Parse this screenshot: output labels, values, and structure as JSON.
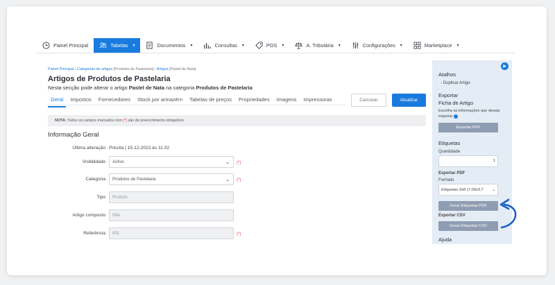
{
  "nav": {
    "items": [
      {
        "label": "Painel Principal",
        "icon": "clock-icon",
        "active": false,
        "dropdown": false
      },
      {
        "label": "Tabelas",
        "icon": "users-icon",
        "active": true,
        "dropdown": true
      },
      {
        "label": "Documentos",
        "icon": "document-icon",
        "active": false,
        "dropdown": true
      },
      {
        "label": "Consultas",
        "icon": "bar-chart-icon",
        "active": false,
        "dropdown": true
      },
      {
        "label": "POS",
        "icon": "tag-icon",
        "active": false,
        "dropdown": true
      },
      {
        "label": "A. Tributária",
        "icon": "scales-icon",
        "active": false,
        "dropdown": true
      },
      {
        "label": "Configurações",
        "icon": "sliders-icon",
        "active": false,
        "dropdown": true
      },
      {
        "label": "Marketplace",
        "icon": "grid-icon",
        "active": false,
        "dropdown": true
      }
    ],
    "accent": "#1a7bde"
  },
  "breadcrumb": {
    "item1": "Painel Principal",
    "item2": "Categorias de artigos",
    "item2_suffix": "[Produtos de Pastelaria]",
    "item3": "Artigos",
    "item3_suffix": "[Pastel de Nata]",
    "separator": "›"
  },
  "page": {
    "title": "Artigos de Produtos de Pastelaria",
    "subtitle_prefix": "Nesta secção pode alterar o artigo",
    "subtitle_article": "Pastel de Nata",
    "subtitle_middle": "na categoria",
    "subtitle_category": "Produtos de Pastelaria"
  },
  "tabs": [
    "Geral",
    "Impostos",
    "Fornecedores",
    "Stock por armazém",
    "Tabelas de preços",
    "Propriedades",
    "Imagens",
    "Impressoras"
  ],
  "actions": {
    "cancel": "Cancelar",
    "update": "Atualizar"
  },
  "note": {
    "label": "NOTA:",
    "text_before": "Todos os campos marcados com",
    "star": "(*)",
    "text_after": "são de preenchimento obrigatório"
  },
  "form": {
    "section_title": "Informação Geral",
    "last_change_label": "Última alteração",
    "last_change_value": "Priscila | 15-12-2022 às 11:32",
    "visibility_label": "Visibilidade",
    "visibility_value": "Activo",
    "category_label": "Categoria",
    "category_value": "Produtos de Pastelaria",
    "type_label": "Tipo",
    "type_value": "Produto",
    "composite_label": "Artigo composto",
    "composite_value": "Não",
    "reference_label": "Referência",
    "reference_value": "001",
    "required_mark": "(*)"
  },
  "sidebar": {
    "shortcuts_title": "Atalhos",
    "duplicate_link": "- Duplicar Artigo",
    "export_title": "Exportar",
    "export_subtitle": "Ficha de Artigo",
    "export_desc": "Escolha as informações que deseja exportar",
    "export_pdf_button": "Exportar PDF",
    "labels_title": "Etiquetas",
    "quantity_label": "Quantidade",
    "quantity_value": "1",
    "export_pdf_label": "Exportar PDF",
    "format_label": "Formato",
    "format_value": "Etiquetas 3x8 (7,00x3,7",
    "generate_pdf_button": "Gerar Etiquetas PDF",
    "export_csv_label": "Exportar CSV",
    "generate_csv_button": "Gerar Etiquetas CSV",
    "help_title": "Ajuda",
    "help_icon": "play-icon"
  }
}
